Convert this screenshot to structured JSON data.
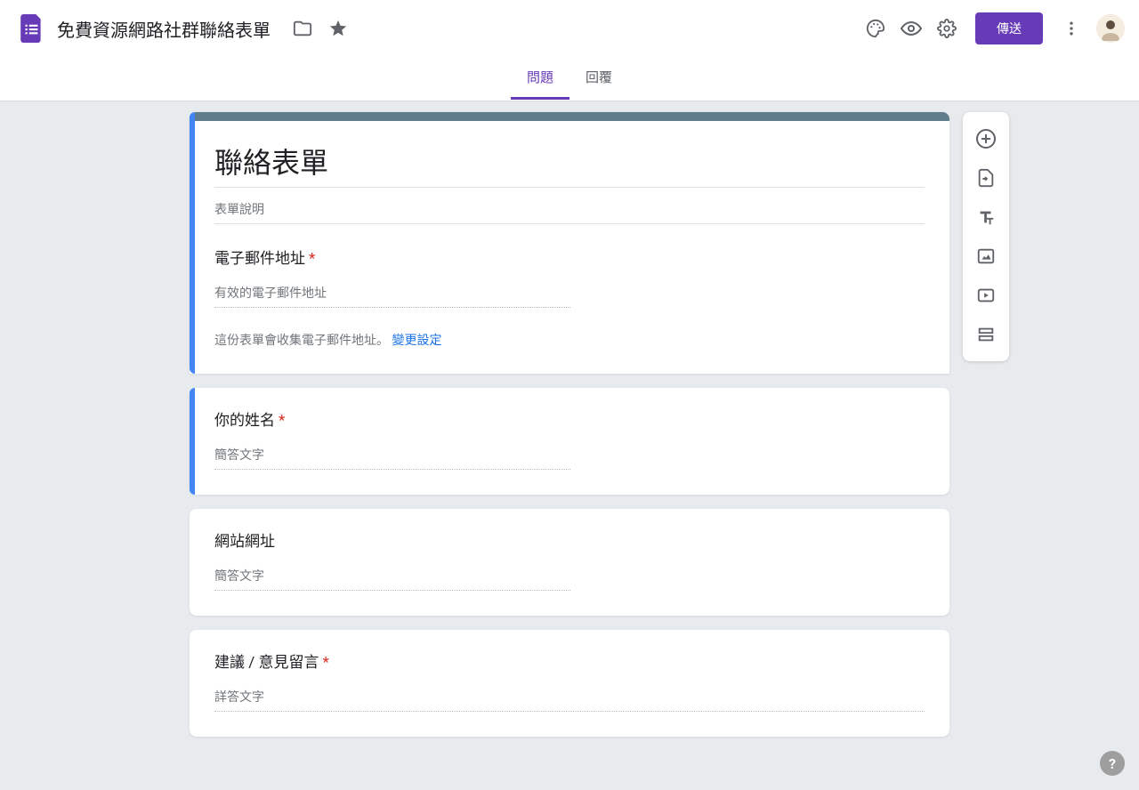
{
  "header": {
    "doc_title": "免費資源網路社群聯絡表單",
    "send_label": "傳送"
  },
  "tabs": {
    "questions": "問題",
    "responses": "回覆"
  },
  "form": {
    "title": "聯絡表單",
    "description_placeholder": "表單說明",
    "email_label": "電子郵件地址",
    "email_placeholder": "有效的電子郵件地址",
    "collect_note": "這份表單會收集電子郵件地址。",
    "change_settings": "變更設定"
  },
  "questions": [
    {
      "label": "你的姓名",
      "required": true,
      "placeholder": "簡答文字"
    },
    {
      "label": "網站網址",
      "required": false,
      "placeholder": "簡答文字"
    },
    {
      "label": "建議 / 意見留言",
      "required": true,
      "placeholder": "詳答文字"
    }
  ],
  "help": "?"
}
